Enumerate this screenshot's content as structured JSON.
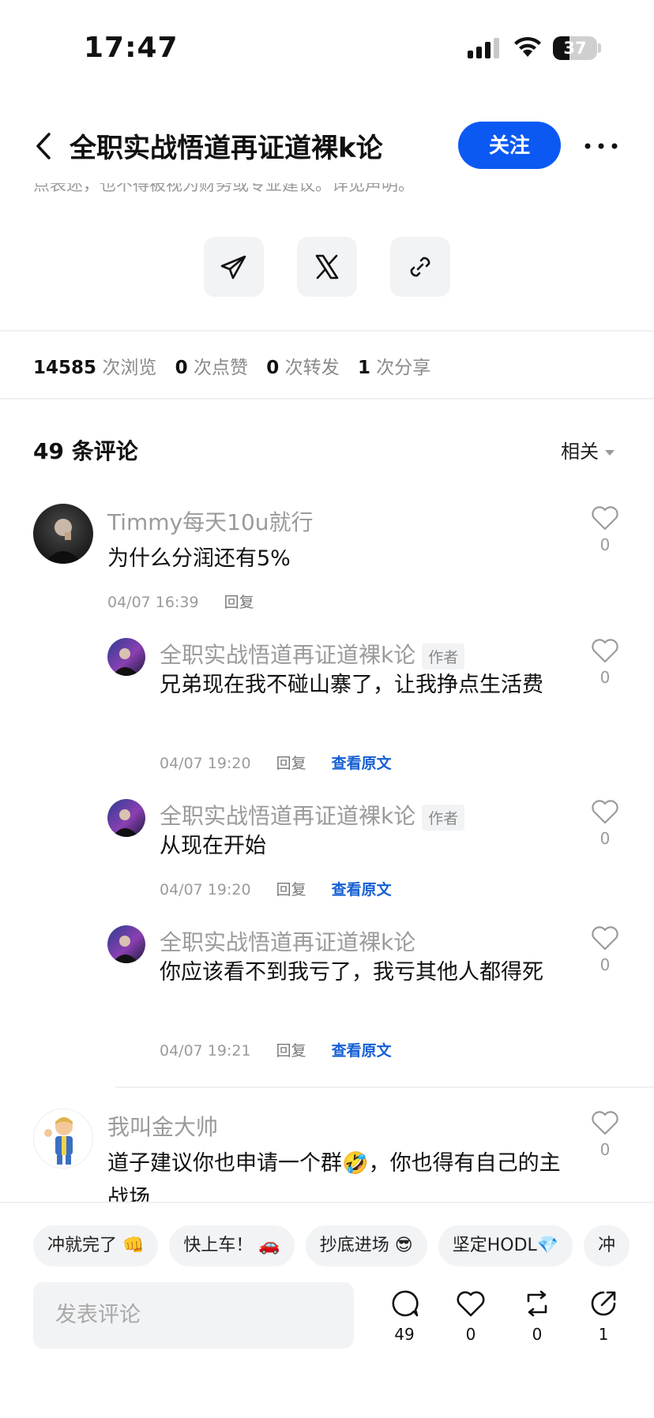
{
  "status": {
    "time": "17:47",
    "battery": "37",
    "battery_level": 0.37
  },
  "header": {
    "title": "全职实战悟道再证道裸k论",
    "follow_label": "关注"
  },
  "disclaimer_cut": "点表述，也不得被视为财务或专业建议。详见声明。",
  "stats": {
    "views": "14585",
    "views_label": "次浏览",
    "likes": "0",
    "likes_label": "次点赞",
    "reposts": "0",
    "reposts_label": "次转发",
    "shares": "1",
    "shares_label": "次分享"
  },
  "comments_header": {
    "title": "49 条评论",
    "sort_label": "相关"
  },
  "comments": [
    {
      "name": "Timmy每天10u就行",
      "text": "为什么分润还有5%",
      "time": "04/07 16:39",
      "reply": "回复",
      "likes": "0"
    },
    {
      "name": "全职实战悟道再证道裸k论",
      "badge": "作者",
      "text": "兄弟现在我不碰山寨了，让我挣点生活费",
      "time": "04/07 19:20",
      "reply": "回复",
      "view_original": "查看原文",
      "likes": "0"
    },
    {
      "name": "全职实战悟道再证道裸k论",
      "badge": "作者",
      "text": "从现在开始",
      "time": "04/07 19:20",
      "reply": "回复",
      "view_original": "查看原文",
      "likes": "0"
    },
    {
      "name": "全职实战悟道再证道裸k论",
      "text": "你应该看不到我亏了，我亏其他人都得死",
      "time": "04/07 19:21",
      "reply": "回复",
      "view_original": "查看原文",
      "likes": "0"
    },
    {
      "name": "我叫金大帅",
      "text": "道子建议你也申请一个群🤣，你也得有自己的主战场",
      "likes": "0"
    }
  ],
  "chips": [
    "冲就完了 👊",
    "快上车！ 🚗",
    "抄底进场 😎",
    "坚定HODL💎",
    "冲"
  ],
  "bottom": {
    "input_placeholder": "发表评论",
    "comment_count": "49",
    "like_count": "0",
    "repost_count": "0",
    "share_count": "1"
  },
  "colors": {
    "accent": "#0b59f2",
    "link": "#1660d4"
  },
  "icons": [
    "back-icon",
    "more-icon",
    "telegram-icon",
    "x-icon",
    "link-icon",
    "heart-icon",
    "comment-icon",
    "repost-icon",
    "share-icon"
  ]
}
